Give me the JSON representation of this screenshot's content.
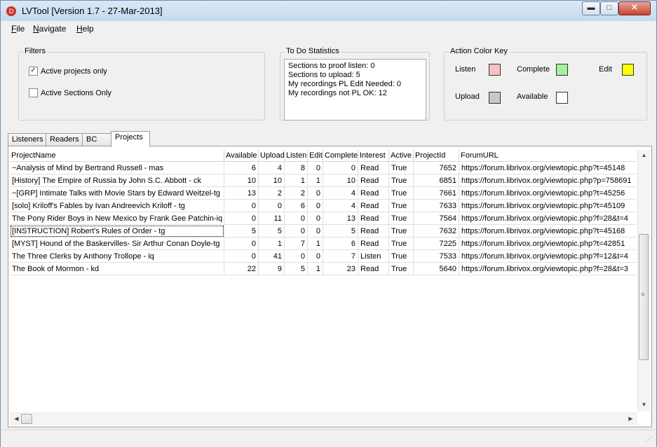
{
  "window": {
    "title": "LVTool [Version 1.7 - 27-Mar-2013]",
    "app_icon_glyph": "D",
    "controls": {
      "minimize": "▬",
      "maximize": "□",
      "close": "✕"
    }
  },
  "menu": [
    {
      "label": "File"
    },
    {
      "label": "Navigate"
    },
    {
      "label": "Help"
    }
  ],
  "filters": {
    "title": "Filters",
    "active_projects_only": {
      "label": "Active projects only",
      "checked": true
    },
    "active_sections_only": {
      "label": "Active Sections Only",
      "checked": false
    }
  },
  "todo_stats": {
    "title": "To Do Statistics",
    "lines": [
      "Sections to proof listen: 0",
      "Sections to upload: 5",
      "My recordings PL Edit Needed: 0",
      "My recordings not PL OK: 12"
    ]
  },
  "color_key": {
    "title": "Action Color Key",
    "items": [
      {
        "label": "Listen",
        "color": "#f8c0c4"
      },
      {
        "label": "Complete",
        "color": "#a6ef9f"
      },
      {
        "label": "Edit",
        "color": "#ffff00"
      },
      {
        "label": "Upload",
        "color": "#c8c8c8"
      },
      {
        "label": "Available",
        "color": "#ffffff"
      }
    ]
  },
  "tabs": [
    {
      "label": "Listeners",
      "active": false
    },
    {
      "label": "Readers",
      "active": false
    },
    {
      "label": "BC",
      "active": false
    },
    {
      "label": "Projects",
      "active": true
    }
  ],
  "table": {
    "columns": [
      "ProjectName",
      "Available",
      "Upload",
      "Listen",
      "Edit",
      "Complete",
      "Interest",
      "Active",
      "ProjectId",
      "ForumURL"
    ],
    "rows": [
      [
        "~Analysis of Mind by Bertrand Russell - mas",
        "6",
        "4",
        "8",
        "0",
        "0",
        "Read",
        "True",
        "7652",
        "https://forum.librivox.org/viewtopic.php?t=45148"
      ],
      [
        "[History] The Empire of Russia by John S.C. Abbott - ck",
        "10",
        "10",
        "1",
        "1",
        "10",
        "Read",
        "True",
        "6851",
        "https://forum.librivox.org/viewtopic.php?p=758691"
      ],
      [
        "~[GRP] Intimate Talks with Movie Stars by Edward Weitzel-tg",
        "13",
        "2",
        "2",
        "0",
        "4",
        "Read",
        "True",
        "7661",
        "https://forum.librivox.org/viewtopic.php?t=45256"
      ],
      [
        "[solo] Kriloff's Fables by Ivan Andreevich Kriloff - tg",
        "0",
        "0",
        "6",
        "0",
        "4",
        "Read",
        "True",
        "7633",
        "https://forum.librivox.org/viewtopic.php?t=45109"
      ],
      [
        "The Pony Rider Boys in New Mexico by Frank Gee Patchin-iq",
        "0",
        "11",
        "0",
        "0",
        "13",
        "Read",
        "True",
        "7564",
        "https://forum.librivox.org/viewtopic.php?f=28&t=4"
      ],
      [
        "[INSTRUCTION] Robert's Rules of Order - tg",
        "5",
        "5",
        "0",
        "0",
        "5",
        "Read",
        "True",
        "7632",
        "https://forum.librivox.org/viewtopic.php?t=45168"
      ],
      [
        "[MYST] Hound of the Baskervilles- Sir Arthur Conan Doyle-tg",
        "0",
        "1",
        "7",
        "1",
        "6",
        "Read",
        "True",
        "7225",
        "https://forum.librivox.org/viewtopic.php?t=42851"
      ],
      [
        "The Three Clerks by Anthony Trollope - iq",
        "0",
        "41",
        "0",
        "0",
        "7",
        "Listen",
        "True",
        "7533",
        "https://forum.librivox.org/viewtopic.php?f=12&t=4"
      ],
      [
        "The Book of Mormon - kd",
        "22",
        "9",
        "5",
        "1",
        "23",
        "Read",
        "True",
        "5640",
        "https://forum.librivox.org/viewtopic.php?f=28&t=3"
      ]
    ],
    "focused_row": 5
  },
  "scrollbar": {
    "up": "▲",
    "down": "▼",
    "left": "◀",
    "right": "▶",
    "grip": "≡"
  }
}
